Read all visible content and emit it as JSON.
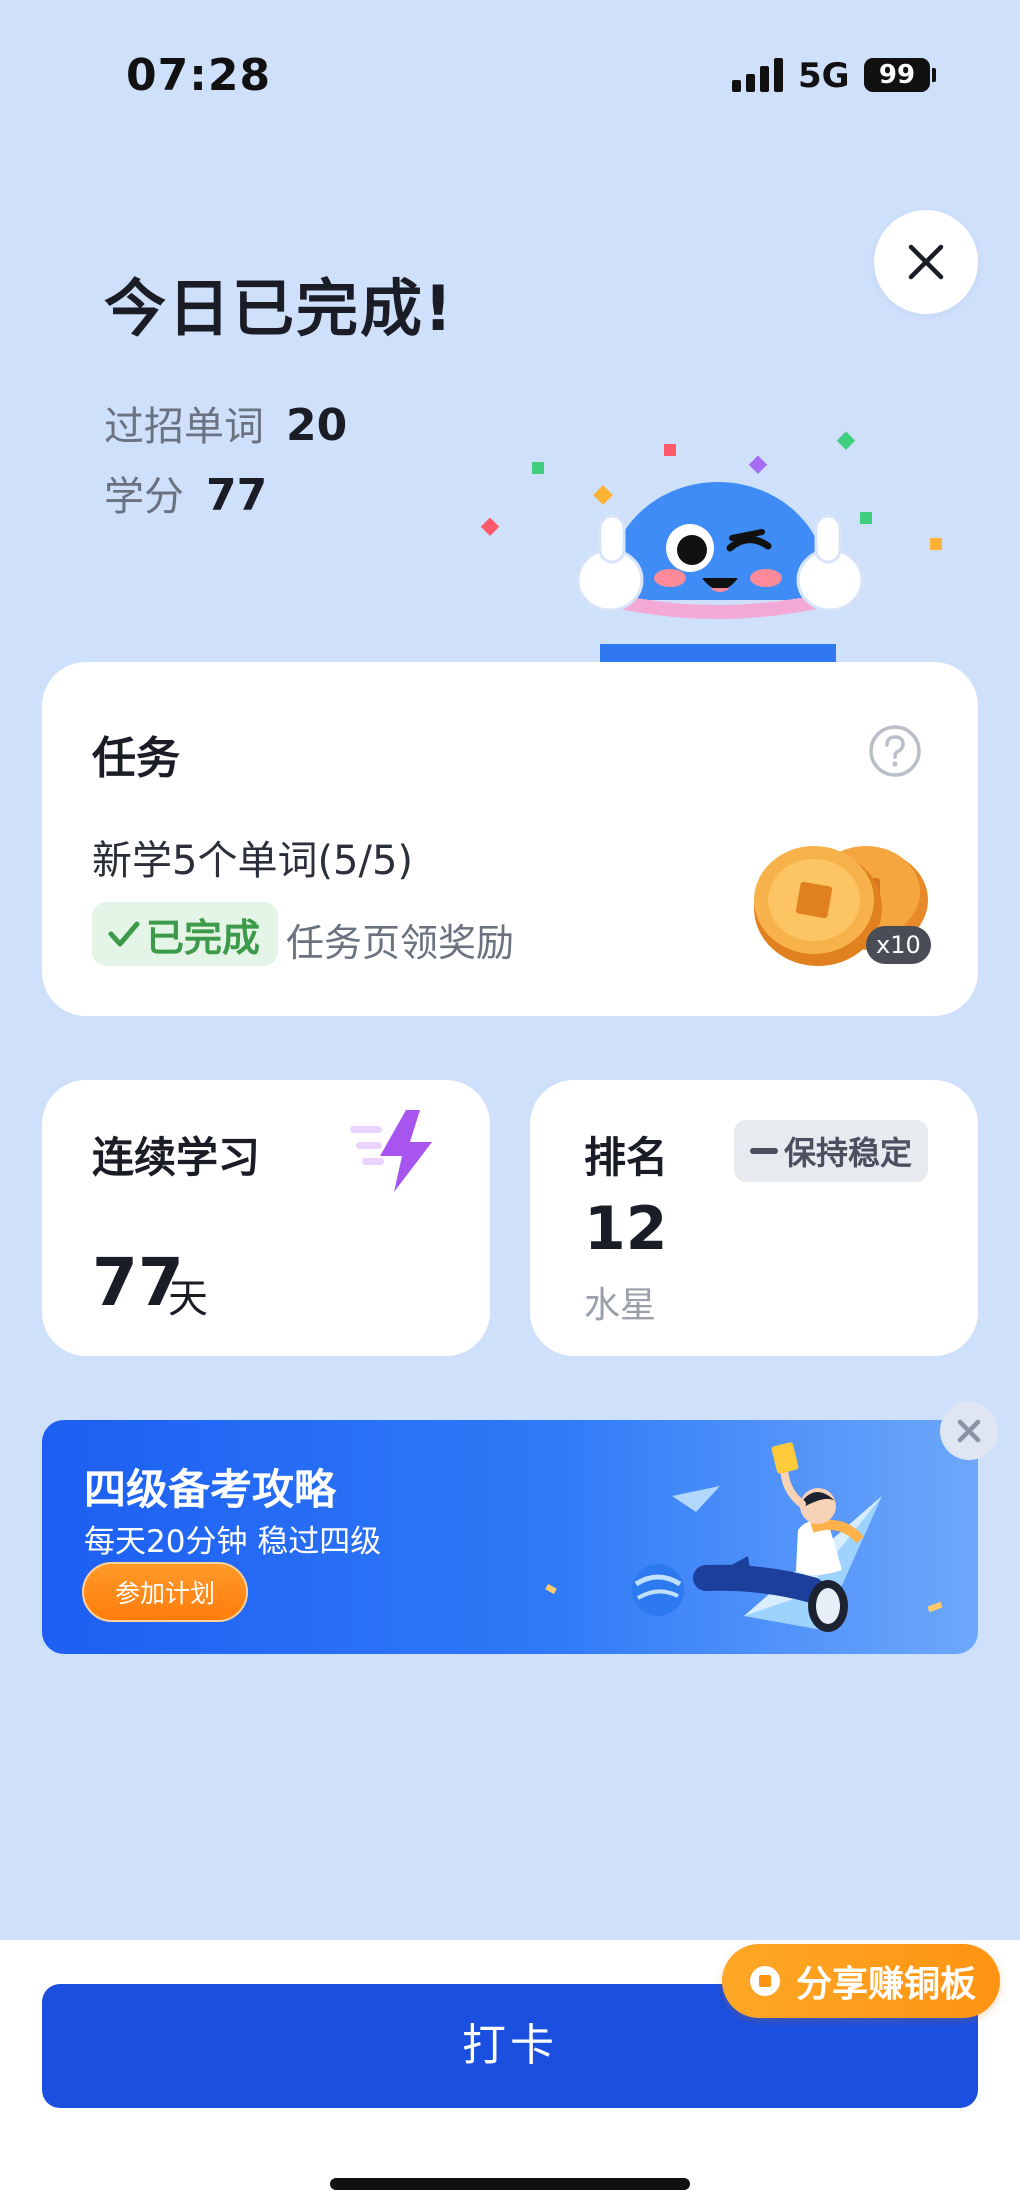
{
  "status_bar": {
    "time": "07:28",
    "network": "5G",
    "battery": "99"
  },
  "header": {
    "title": "今日已完成!",
    "stats": [
      {
        "label": "过招单词",
        "value": "20"
      },
      {
        "label": "学分",
        "value": "77"
      }
    ]
  },
  "task_card": {
    "title": "任务",
    "task_name": "新学5个单词(5/5)",
    "done_label": "已完成",
    "hint": "任务页领奖励",
    "reward_multiplier": "x10"
  },
  "streak_card": {
    "label": "连续学习",
    "value": "77",
    "unit": "天"
  },
  "rank_card": {
    "label": "排名",
    "trend": "保持稳定",
    "value": "12",
    "league": "水星"
  },
  "banner": {
    "title": "四级备考攻略",
    "subtitle": "每天20分钟 稳过四级",
    "button": "参加计划"
  },
  "share_pill": "分享赚铜板",
  "checkin_button": "打卡",
  "colors": {
    "background": "#cfe0fb",
    "primary": "#1b4fe0",
    "success": "#3c9a4a",
    "accent_orange": "#ff9412"
  },
  "icons": [
    "close-icon",
    "help-icon",
    "check-icon",
    "coins-icon",
    "lightning-icon",
    "dash-icon",
    "paper-plane-icon",
    "coin-icon"
  ]
}
